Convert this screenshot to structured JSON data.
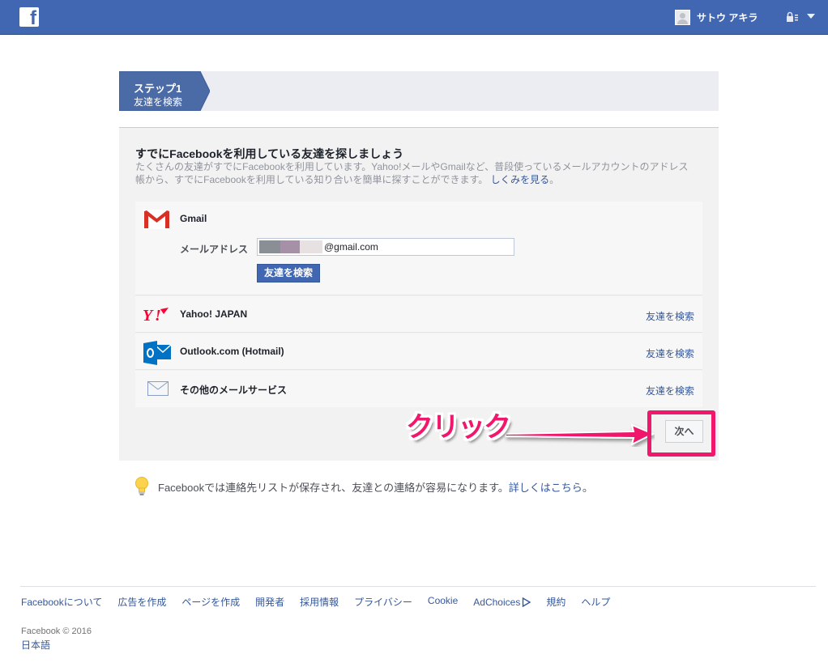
{
  "topbar": {
    "user_name": "サトウ アキラ",
    "icons": [
      "facebook-logo",
      "avatar",
      "privacy-lock-icon",
      "chevron-down-icon"
    ],
    "color": "#4267b2"
  },
  "step": {
    "title": "ステップ1",
    "subtitle": "友達を検索"
  },
  "panel": {
    "title": "すでにFacebookを利用している友達を探しましょう",
    "description_line1": "たくさんの友達がすでにFacebookを利用しています。Yahoo!メールやGmailなど、普段使っているメールアカウントのアドレス",
    "description_line2": "帳から、すでにFacebookを利用している知り合いを簡単に探すことができます。",
    "learn_more": "しくみを見る",
    "learn_more_suffix": "。"
  },
  "providers": {
    "gmail": {
      "name": "Gmail",
      "email_label": "メールアドレス",
      "email_value": "@gmail.com",
      "search_button": "友達を検索"
    },
    "yahoo": {
      "name": "Yahoo! JAPAN",
      "link": "友達を検索"
    },
    "outlook": {
      "name": "Outlook.com (Hotmail)",
      "link": "友達を検索"
    },
    "other": {
      "name": "その他のメールサービス",
      "link": "友達を検索"
    }
  },
  "next_button": "次へ",
  "annotation": {
    "text": "クリック",
    "color": "#f0176c"
  },
  "info": {
    "text": "Facebookでは連絡先リストが保存され、友達との連絡が容易になります。",
    "link": "詳しくはこちら",
    "suffix": "。"
  },
  "footer": {
    "links": [
      "Facebookについて",
      "広告を作成",
      "ページを作成",
      "開発者",
      "採用情報",
      "プライバシー",
      "Cookie",
      "AdChoices",
      "規約",
      "ヘルプ"
    ],
    "copyright": "Facebook © 2016",
    "language": "日本語"
  }
}
